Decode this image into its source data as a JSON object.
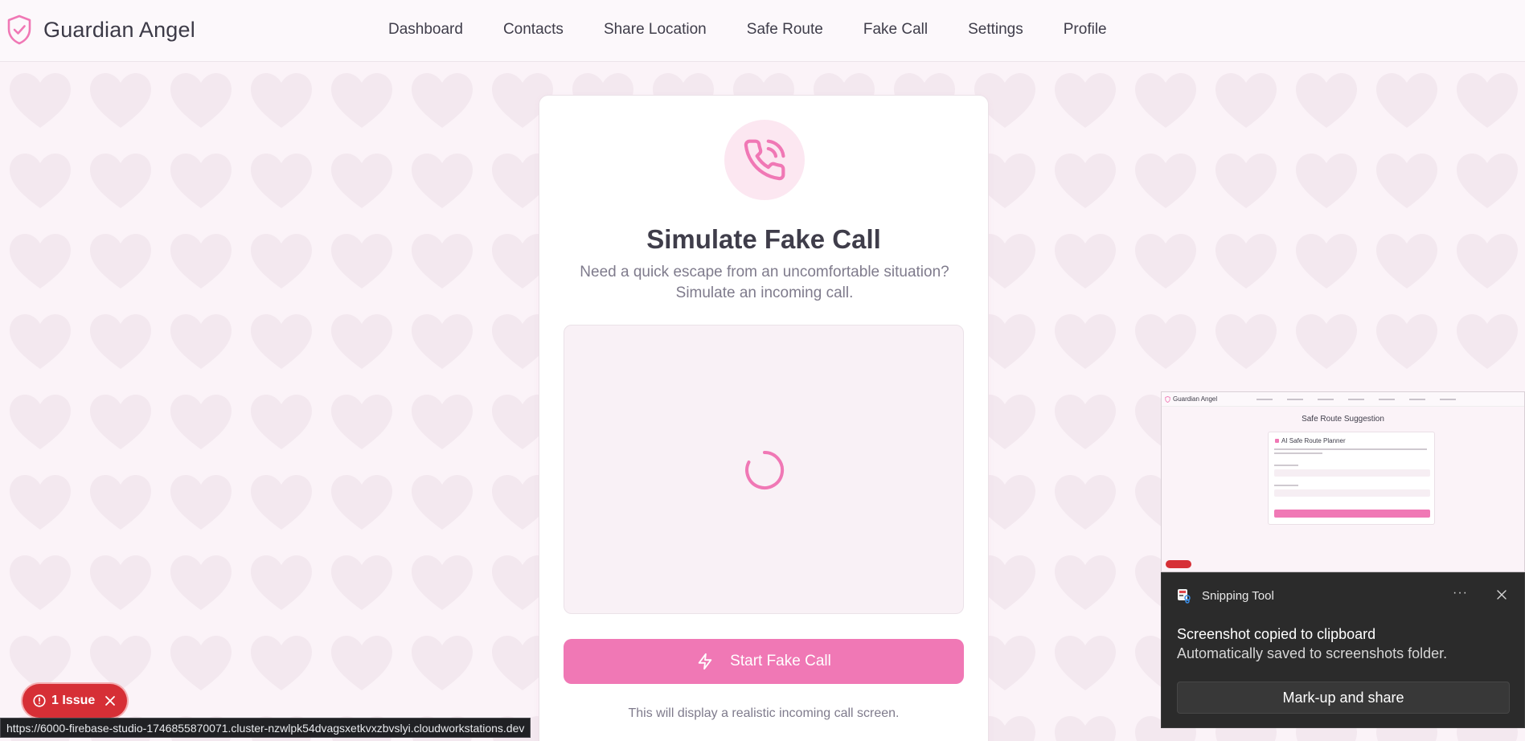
{
  "app": {
    "name": "Guardian Angel",
    "brand_color": "#f078b5",
    "logo_icon": "shield-check-icon"
  },
  "nav": {
    "items": [
      "Dashboard",
      "Contacts",
      "Share Location",
      "Safe Route",
      "Fake Call",
      "Settings",
      "Profile"
    ]
  },
  "card": {
    "icon": "phone-calling-icon",
    "title": "Simulate Fake Call",
    "description": "Need a quick escape from an uncomfortable situation? Simulate an incoming call.",
    "preview_state": "loading",
    "button_label": "Start Fake Call",
    "button_icon": "zap-icon",
    "footer_note": "This will display a realistic incoming call screen."
  },
  "issue_badge": {
    "label": "1 Issue",
    "color": "#d62f36"
  },
  "status_url": "https://6000-firebase-studio-1746855870071.cluster-nzwlpk54dvagsxetkvxzbvslyi.cloudworkstations.dev",
  "snip_thumbnail": {
    "brand": "Guardian Angel",
    "page_title": "Safe Route Suggestion",
    "card_title": "AI Safe Route Planner"
  },
  "toast": {
    "app_name": "Snipping Tool",
    "more_label": "···",
    "title": "Screenshot copied to clipboard",
    "body": "Automatically saved to screenshots folder.",
    "action_label": "Mark-up and share"
  }
}
